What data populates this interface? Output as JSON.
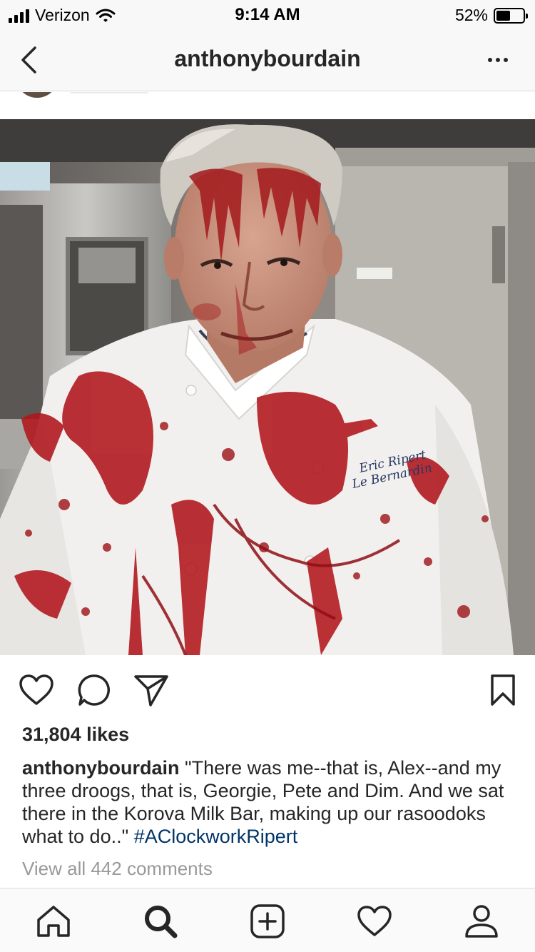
{
  "status_bar": {
    "carrier": "Verizon",
    "time": "9:14 AM",
    "battery_percent": "52%",
    "battery_level": 0.52,
    "signal_icon": "signal-bars-icon",
    "wifi_icon": "wifi-icon"
  },
  "nav": {
    "title": "anthonybourdain",
    "back_icon": "chevron-left-icon",
    "more_icon": "more-dots-icon"
  },
  "post": {
    "photo_alt": "chef jacket embroidery",
    "embroidery_line1": "Eric Ripert",
    "embroidery_line2": "Le Bernardin",
    "likes": "31,804 likes",
    "caption_user": "anthonybourdain",
    "caption_text": " \"There was me--that is, Alex--and my three droogs, that is, Georgie, Pete and Dim. And we sat there in the Korova Milk Bar, making up our rasoodoks what to do..\" ",
    "hashtag": "#AClockworkRipert",
    "view_comments": "View all 442 comments"
  },
  "actions": [
    "heart-icon",
    "comment-icon",
    "share-icon",
    "bookmark-icon"
  ],
  "tabbar": [
    "home-icon",
    "search-icon",
    "add-post-icon",
    "activity-heart-icon",
    "profile-icon"
  ],
  "colors": {
    "text": "#262626",
    "hashtag": "#003569",
    "muted": "#999999",
    "bar_bg": "#f8f8f8",
    "divider": "#dbdbdb"
  }
}
